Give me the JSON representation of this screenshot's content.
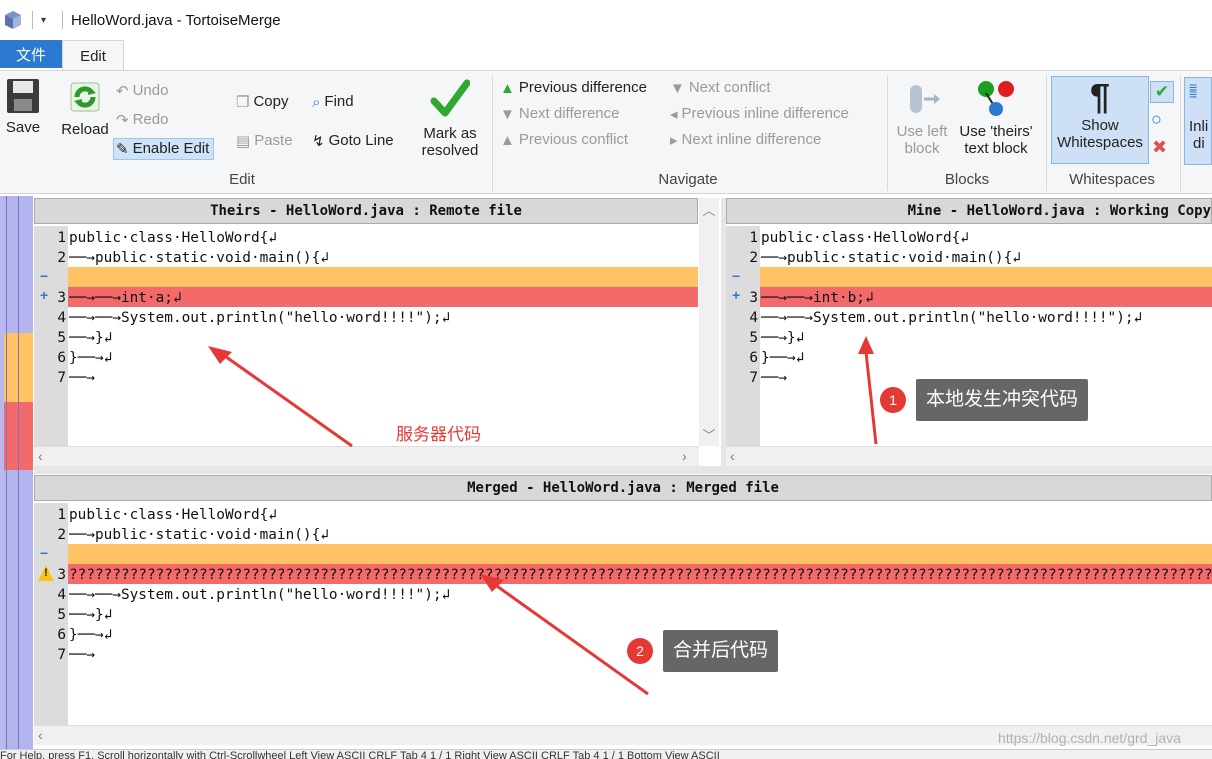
{
  "window": {
    "title": "HelloWord.java - TortoiseMerge",
    "qa_dropdown": "▾"
  },
  "tabs": {
    "file": "文件",
    "edit": "Edit"
  },
  "ribbon": {
    "save": "Save",
    "reload": "Reload",
    "undo": "Undo",
    "redo": "Redo",
    "enable_edit": "Enable Edit",
    "copy": "Copy",
    "paste": "Paste",
    "find": "Find",
    "goto_line": "Goto Line",
    "mark_resolved_1": "Mark as",
    "mark_resolved_2": "resolved",
    "edit_group": "Edit",
    "prev_diff": "Previous difference",
    "next_diff": "Next difference",
    "prev_conflict": "Previous conflict",
    "next_conflict": "Next conflict",
    "prev_inline": "Previous inline difference",
    "next_inline": "Next inline difference",
    "navigate_group": "Navigate",
    "use_left_1": "Use left",
    "use_left_2": "block",
    "use_theirs_1": "Use 'theirs'",
    "use_theirs_2": "text block",
    "blocks_group": "Blocks",
    "show_ws_1": "Show",
    "show_ws_2": "Whitespaces",
    "ws_group": "Whitespaces",
    "inline_1": "Inli",
    "inline_2": "di"
  },
  "theirs": {
    "header": "Theirs - HelloWord.java : Remote file",
    "lines": [
      {
        "num": "1",
        "text": "public·class·HelloWord{↲"
      },
      {
        "num": "2",
        "text": "──→public·static·void·main(){↲"
      },
      {
        "num": "",
        "text": ""
      },
      {
        "num": "3",
        "text": "──→──→int·a;↲"
      },
      {
        "num": "4",
        "text": "──→──→System.out.println(\"hello·word!!!!\");↲"
      },
      {
        "num": "5",
        "text": "──→}↲"
      },
      {
        "num": "6",
        "text": "}──→↲"
      },
      {
        "num": "7",
        "text": "──→"
      }
    ]
  },
  "mine": {
    "header": "Mine - HelloWord.java : Working Copy",
    "lines": [
      {
        "num": "1",
        "text": "public·class·HelloWord{↲"
      },
      {
        "num": "2",
        "text": "──→public·static·void·main(){↲"
      },
      {
        "num": "",
        "text": ""
      },
      {
        "num": "3",
        "text": "──→──→int·b;↲"
      },
      {
        "num": "4",
        "text": "──→──→System.out.println(\"hello·word!!!!\");↲"
      },
      {
        "num": "5",
        "text": "──→}↲"
      },
      {
        "num": "6",
        "text": "}──→↲"
      },
      {
        "num": "7",
        "text": "──→"
      }
    ]
  },
  "merged": {
    "header": "Merged - HelloWord.java : Merged file",
    "lines": [
      {
        "num": "1",
        "text": "public·class·HelloWord{↲"
      },
      {
        "num": "2",
        "text": "──→public·static·void·main(){↲"
      },
      {
        "num": "",
        "text": ""
      },
      {
        "num": "3",
        "text": "?????????????????????????????????????????????????????????????????????????????????????????????????????????????????????????????????????????????????????????????????????????????????????????????????????????????????"
      },
      {
        "num": "4",
        "text": "──→──→System.out.println(\"hello·word!!!!\");↲"
      },
      {
        "num": "5",
        "text": "──→}↲"
      },
      {
        "num": "6",
        "text": "}──→↲"
      },
      {
        "num": "7",
        "text": "──→"
      }
    ]
  },
  "annotations": {
    "server_code": "服务器代码",
    "badge1": "1",
    "local_conflict": "本地发生冲突代码",
    "badge2": "2",
    "merged_code": "合并后代码"
  },
  "status": {
    "text": "For Help, press F1. Scroll horizontally with Ctrl-Scrollwheel    Left View    ASCII    CRLF    Tab 4    1 / 1    Right View    ASCII    CRLF    Tab 4    1 / 1    Bottom View    ASCII"
  },
  "watermark": "https://blog.csdn.net/grd_java",
  "colors": {
    "conflict_red": "#f46a6a",
    "empty_orange": "#ffc366",
    "file_tab_blue": "#2b79d0"
  }
}
